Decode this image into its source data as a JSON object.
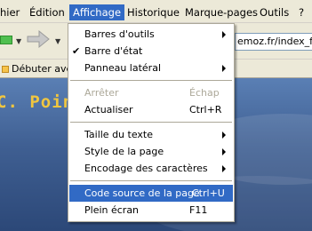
{
  "menubar": {
    "items": [
      "hier",
      "Édition",
      "Affichage",
      "Historique",
      "Marque-pages",
      "Outils",
      "?"
    ]
  },
  "toolbar": {
    "url_text": "emoz.fr/index_file"
  },
  "bookmarks": {
    "label": "Débuter avec"
  },
  "page": {
    "title_fragment": "C. Pointe"
  },
  "dropdown": {
    "items": [
      {
        "label": "Barres d'outils",
        "submenu": true
      },
      {
        "label": "Barre d'état",
        "checked": true
      },
      {
        "label": "Panneau latéral",
        "submenu": true
      },
      {
        "label": "Arrêter",
        "shortcut": "Échap",
        "disabled": true
      },
      {
        "label": "Actualiser",
        "shortcut": "Ctrl+R"
      },
      {
        "label": "Taille du texte",
        "submenu": true
      },
      {
        "label": "Style de la page",
        "submenu": true
      },
      {
        "label": "Encodage des caractères",
        "submenu": true
      },
      {
        "label": "Code source de la page",
        "shortcut": "Ctrl+U",
        "highlighted": true
      },
      {
        "label": "Plein écran",
        "shortcut": "F11"
      }
    ]
  },
  "colors": {
    "highlight": "#316ac5",
    "menubar": "#ece9d8",
    "page_title": "#f0c640"
  }
}
